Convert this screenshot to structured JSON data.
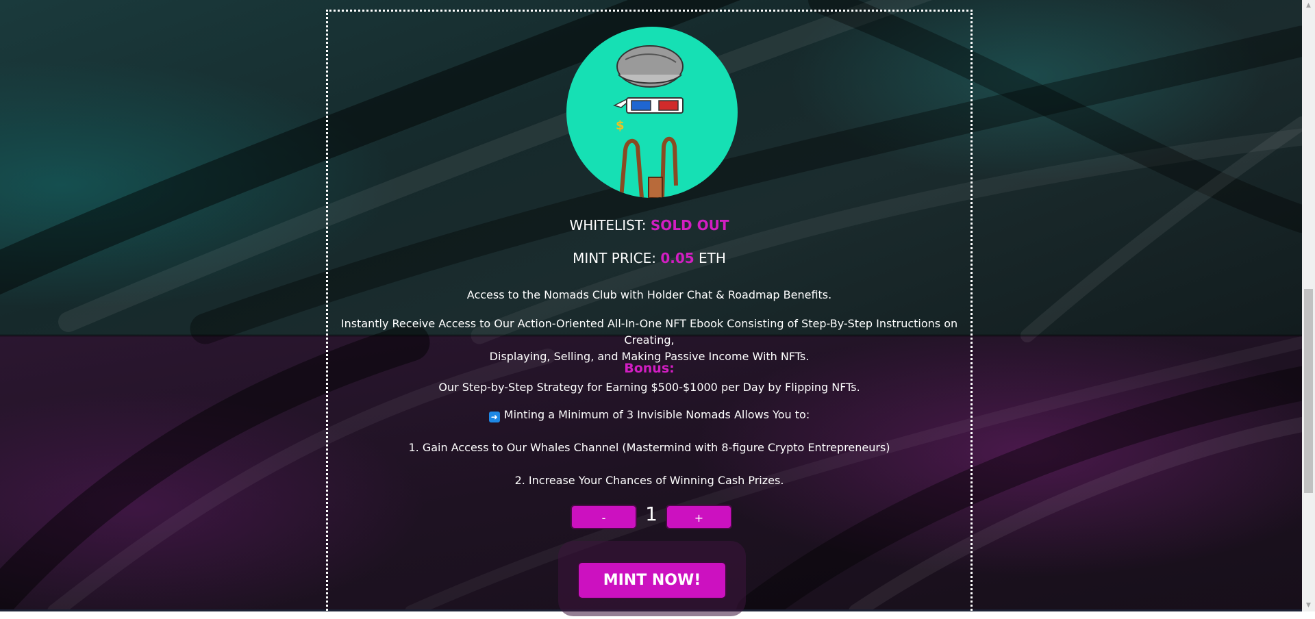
{
  "status": {
    "whitelist_label": "WHITELIST:",
    "whitelist_value": "SOLD OUT",
    "mint_price_label": "MINT PRICE:",
    "mint_price_value": "0.05",
    "mint_price_unit": "ETH"
  },
  "description": {
    "line_1": "Access to the Nomads Club with Holder Chat & Roadmap Benefits.",
    "line_2a": "Instantly Receive Access to Our Action-Oriented All-In-One NFT Ebook Consisting of Step-By-Step Instructions on Creating,",
    "line_2b": "Displaying, Selling, and Making Passive Income With NFTs.",
    "bonus_title": "Bonus:",
    "bonus_text": "Our Step-by-Step Strategy for Earning $500-$1000 per Day by Flipping NFTs.",
    "minting_line": "Minting a Minimum of 3 Invisible Nomads Allows You to:",
    "benefit_1": "1. Gain Access to Our Whales Channel (Mastermind with 8-figure Crypto Entrepreneurs)",
    "benefit_2": "2. Increase Your Chances of Winning Cash Prizes."
  },
  "mint": {
    "minus_label": "-",
    "quantity": "1",
    "plus_label": "+",
    "mint_button_label": "MINT NOW!"
  },
  "colors": {
    "accent": "#d21ec2",
    "avatar_bg": "#16e0b4",
    "arrow_icon": "#1e88e5"
  },
  "icons": {
    "arrow": "right-arrow-icon",
    "avatar": "nft-avatar-illustration"
  }
}
